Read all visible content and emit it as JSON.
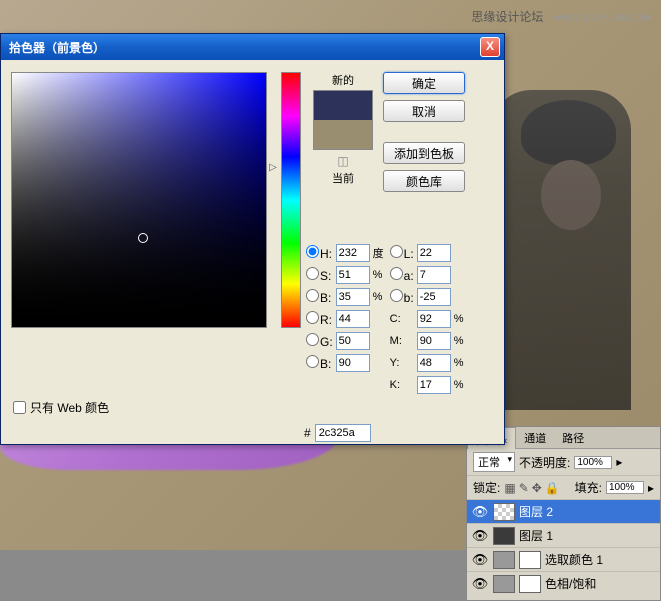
{
  "watermark": {
    "text": "思缘设计论坛",
    "url": "WWW.MISSYUAN.COM"
  },
  "dialog": {
    "title": "拾色器（前景色）",
    "close": "X",
    "preview_new_label": "新的",
    "preview_current_label": "当前",
    "buttons": {
      "ok": "确定",
      "cancel": "取消",
      "add_swatch": "添加到色板",
      "color_lib": "颜色库"
    },
    "hsb": {
      "h_label": "H:",
      "s_label": "S:",
      "b_label": "B:",
      "h": "232",
      "s": "51",
      "b": "35",
      "h_unit": "度",
      "pct": "%"
    },
    "lab": {
      "l_label": "L:",
      "a_label": "a:",
      "b_label": "b:",
      "l": "22",
      "a": "7",
      "b": "-25"
    },
    "rgb": {
      "r_label": "R:",
      "g_label": "G:",
      "b_label": "B:",
      "r": "44",
      "g": "50",
      "b": "90"
    },
    "cmyk": {
      "c_label": "C:",
      "m_label": "M:",
      "y_label": "Y:",
      "k_label": "K:",
      "c": "92",
      "m": "90",
      "y": "48",
      "k": "17",
      "pct": "%"
    },
    "hex_label": "#",
    "hex": "2c325a",
    "web_only": "只有 Web 颜色"
  },
  "layers": {
    "tabs": [
      "图层",
      "通道",
      "路径"
    ],
    "blend_mode": "正常",
    "opacity_label": "不透明度:",
    "opacity": "100%",
    "lock_label": "锁定:",
    "fill_label": "填充:",
    "fill": "100%",
    "items": [
      {
        "name": "图层 2"
      },
      {
        "name": "图层 1"
      },
      {
        "name": "选取颜色 1"
      },
      {
        "name": "色相/饱和"
      }
    ]
  }
}
